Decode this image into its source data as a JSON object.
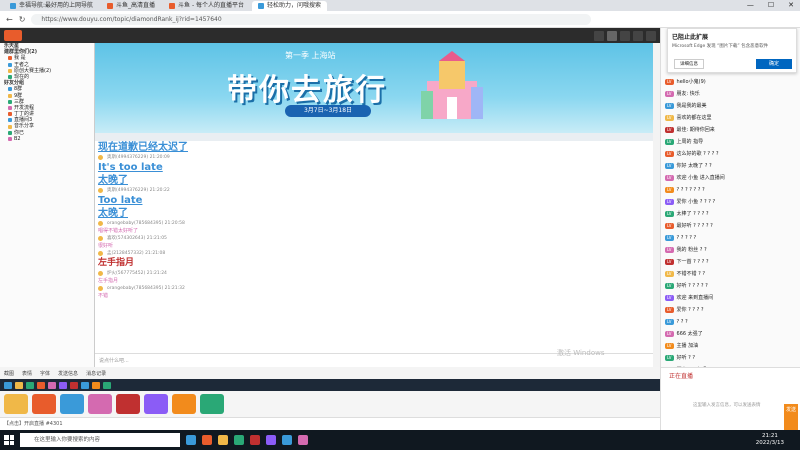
{
  "browser": {
    "tabs": [
      {
        "label": "幸福导航:最好用的上网导航",
        "color": "#3a9ad9"
      },
      {
        "label": "斗鱼_高清直播",
        "color": "#e85c2c"
      },
      {
        "label": "斗鱼 - 每个人的直播平台",
        "color": "#e85c2c"
      },
      {
        "label": "轻松助力，问哦搜索",
        "color": "#3a9ad9",
        "active": true
      }
    ],
    "url": "https://www.douyu.com/topic/diamondRank_ij?rid=1457640",
    "window_controls": [
      "—",
      "☐",
      "✕"
    ]
  },
  "sidebar": {
    "header": "乐天星",
    "sections": [
      {
        "label": "建群里你们(2)",
        "rows": [
          "我 是",
          "王者之",
          "原创大赛主播(2)",
          "现在的"
        ]
      },
      {
        "label": "好友分组",
        "rows": [
          "8群",
          "9群",
          "三群",
          "开发流程",
          "丁丁的讲",
          "直播间3",
          "音乐分享",
          "你已",
          "B2"
        ]
      }
    ]
  },
  "banner": {
    "season": "第一季  上海站",
    "title": "带你去旅行",
    "date": "3月7日~3月18日"
  },
  "chat_messages": [
    {
      "big": "现在道歉已经太迟了",
      "style": "big"
    },
    {
      "meta": "奥斯(4994376229)  21:20:09"
    },
    {
      "big": "It's too late",
      "style": "big"
    },
    {
      "big": "太晚了",
      "style": "big"
    },
    {
      "meta": "奥斯(4994376229)  21:20:22"
    },
    {
      "big": "Too late",
      "style": "big"
    },
    {
      "big": "太晚了",
      "style": "big"
    },
    {
      "meta": "orangebaby(785684395)  21:20:58"
    },
    {
      "small": "唱得不错太好听了",
      "style": "pink"
    },
    {
      "meta": "喜欢(574302643)  21:21:05"
    },
    {
      "small": "很好听",
      "style": "pink"
    },
    {
      "meta": "孟(2128457332)  21:21:08"
    },
    {
      "big": "左手指月",
      "style": "red"
    },
    {
      "meta": "炉火(567775452)  21:21:24"
    },
    {
      "small": "左手指月",
      "style": "pink"
    },
    {
      "meta": "orangebaby(785684395)  21:21:32"
    },
    {
      "small": "不错",
      "style": "pink"
    }
  ],
  "input": {
    "placeholder": "说点什么吧...",
    "watermark": "激活 Windows"
  },
  "tooltip_items": [
    "截图",
    "表情",
    "字体",
    "发送信息",
    "消息记录"
  ],
  "gifts": [
    "#f0b848",
    "#e85c2c",
    "#3a9ad9",
    "#d46ab0",
    "#c03030",
    "#8b5cf6",
    "#f28b1c",
    "#2aa876"
  ],
  "footer": "【点击】开启直播 #4301",
  "right_panel": {
    "popup": {
      "title": "已阻止此扩展",
      "desc": "Microsoft Edge 发现 “图片下载” 包含恶意软件",
      "left_btn": "详细信息",
      "right_btn": "确定"
    },
    "rows": [
      {
        "badge": "#e85c2c",
        "text": "hello小鬼(9)"
      },
      {
        "badge": "#d46ab0",
        "text": "朋友: 快乐"
      },
      {
        "badge": "#3a9ad9",
        "text": "我是我的最美"
      },
      {
        "badge": "#f0b848",
        "text": "喜欢的都在这里"
      },
      {
        "badge": "#c03030",
        "text": "最佳: 期待你回来"
      },
      {
        "badge": "#2aa876",
        "text": "上周的 指导"
      },
      {
        "badge": "#e85c2c",
        "text": "这么好的歌 ? ? ? ?"
      },
      {
        "badge": "#3a9ad9",
        "text": "你好 太晚了 ? ?"
      },
      {
        "badge": "#d46ab0",
        "text": "欢迎 小鱼 进入直播间"
      },
      {
        "badge": "#f28b1c",
        "text": "? ? ? ? ? ? ?"
      },
      {
        "badge": "#8b5cf6",
        "text": "爱你 小鱼 ? ? ? ?"
      },
      {
        "badge": "#2aa876",
        "text": "太棒了 ? ? ? ?"
      },
      {
        "badge": "#e85c2c",
        "text": "最好听 ? ? ? ? ?"
      },
      {
        "badge": "#3a9ad9",
        "text": "? ? ? ? ?"
      },
      {
        "badge": "#d46ab0",
        "text": "我的 粉丝 ? ?"
      },
      {
        "badge": "#c03030",
        "text": "下一首 ? ? ? ?"
      },
      {
        "badge": "#f0b848",
        "text": "不错不错 ? ?"
      },
      {
        "badge": "#2aa876",
        "text": "好听 ? ? ? ? ?"
      },
      {
        "badge": "#8b5cf6",
        "text": "欢迎 来到直播间"
      },
      {
        "badge": "#e85c2c",
        "text": "爱你 ? ? ? ?"
      },
      {
        "badge": "#3a9ad9",
        "text": "? ? ?"
      },
      {
        "badge": "#d46ab0",
        "text": "666 太强了"
      },
      {
        "badge": "#f28b1c",
        "text": "主播 加油"
      },
      {
        "badge": "#2aa876",
        "text": "好听 ? ?"
      },
      {
        "badge": "#c03030",
        "text": "漂亮 ? ? 在吗 ?"
      }
    ],
    "status": "正在直播",
    "send_label": "发送",
    "input_placeholder": "这里输入发言信息，可以发送表情"
  },
  "taskbar": {
    "search_placeholder": "在这里输入你要搜索的内容",
    "apps": [
      "#3a9ad9",
      "#e85c2c",
      "#f0b848",
      "#2aa876",
      "#c03030",
      "#8b5cf6",
      "#3a9ad9",
      "#d46ab0"
    ],
    "time": "21:21",
    "date": "2022/3/13"
  }
}
